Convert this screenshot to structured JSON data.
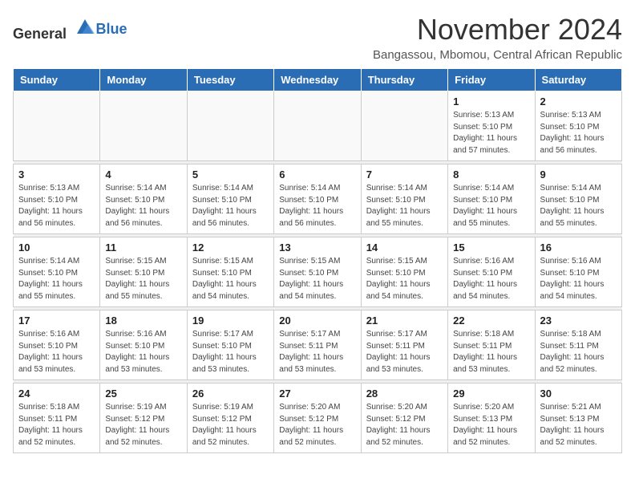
{
  "logo": {
    "general": "General",
    "blue": "Blue"
  },
  "title": "November 2024",
  "subtitle": "Bangassou, Mbomou, Central African Republic",
  "weekdays": [
    "Sunday",
    "Monday",
    "Tuesday",
    "Wednesday",
    "Thursday",
    "Friday",
    "Saturday"
  ],
  "weeks": [
    [
      {
        "day": "",
        "info": ""
      },
      {
        "day": "",
        "info": ""
      },
      {
        "day": "",
        "info": ""
      },
      {
        "day": "",
        "info": ""
      },
      {
        "day": "",
        "info": ""
      },
      {
        "day": "1",
        "info": "Sunrise: 5:13 AM\nSunset: 5:10 PM\nDaylight: 11 hours\nand 57 minutes."
      },
      {
        "day": "2",
        "info": "Sunrise: 5:13 AM\nSunset: 5:10 PM\nDaylight: 11 hours\nand 56 minutes."
      }
    ],
    [
      {
        "day": "3",
        "info": "Sunrise: 5:13 AM\nSunset: 5:10 PM\nDaylight: 11 hours\nand 56 minutes."
      },
      {
        "day": "4",
        "info": "Sunrise: 5:14 AM\nSunset: 5:10 PM\nDaylight: 11 hours\nand 56 minutes."
      },
      {
        "day": "5",
        "info": "Sunrise: 5:14 AM\nSunset: 5:10 PM\nDaylight: 11 hours\nand 56 minutes."
      },
      {
        "day": "6",
        "info": "Sunrise: 5:14 AM\nSunset: 5:10 PM\nDaylight: 11 hours\nand 56 minutes."
      },
      {
        "day": "7",
        "info": "Sunrise: 5:14 AM\nSunset: 5:10 PM\nDaylight: 11 hours\nand 55 minutes."
      },
      {
        "day": "8",
        "info": "Sunrise: 5:14 AM\nSunset: 5:10 PM\nDaylight: 11 hours\nand 55 minutes."
      },
      {
        "day": "9",
        "info": "Sunrise: 5:14 AM\nSunset: 5:10 PM\nDaylight: 11 hours\nand 55 minutes."
      }
    ],
    [
      {
        "day": "10",
        "info": "Sunrise: 5:14 AM\nSunset: 5:10 PM\nDaylight: 11 hours\nand 55 minutes."
      },
      {
        "day": "11",
        "info": "Sunrise: 5:15 AM\nSunset: 5:10 PM\nDaylight: 11 hours\nand 55 minutes."
      },
      {
        "day": "12",
        "info": "Sunrise: 5:15 AM\nSunset: 5:10 PM\nDaylight: 11 hours\nand 54 minutes."
      },
      {
        "day": "13",
        "info": "Sunrise: 5:15 AM\nSunset: 5:10 PM\nDaylight: 11 hours\nand 54 minutes."
      },
      {
        "day": "14",
        "info": "Sunrise: 5:15 AM\nSunset: 5:10 PM\nDaylight: 11 hours\nand 54 minutes."
      },
      {
        "day": "15",
        "info": "Sunrise: 5:16 AM\nSunset: 5:10 PM\nDaylight: 11 hours\nand 54 minutes."
      },
      {
        "day": "16",
        "info": "Sunrise: 5:16 AM\nSunset: 5:10 PM\nDaylight: 11 hours\nand 54 minutes."
      }
    ],
    [
      {
        "day": "17",
        "info": "Sunrise: 5:16 AM\nSunset: 5:10 PM\nDaylight: 11 hours\nand 53 minutes."
      },
      {
        "day": "18",
        "info": "Sunrise: 5:16 AM\nSunset: 5:10 PM\nDaylight: 11 hours\nand 53 minutes."
      },
      {
        "day": "19",
        "info": "Sunrise: 5:17 AM\nSunset: 5:10 PM\nDaylight: 11 hours\nand 53 minutes."
      },
      {
        "day": "20",
        "info": "Sunrise: 5:17 AM\nSunset: 5:11 PM\nDaylight: 11 hours\nand 53 minutes."
      },
      {
        "day": "21",
        "info": "Sunrise: 5:17 AM\nSunset: 5:11 PM\nDaylight: 11 hours\nand 53 minutes."
      },
      {
        "day": "22",
        "info": "Sunrise: 5:18 AM\nSunset: 5:11 PM\nDaylight: 11 hours\nand 53 minutes."
      },
      {
        "day": "23",
        "info": "Sunrise: 5:18 AM\nSunset: 5:11 PM\nDaylight: 11 hours\nand 52 minutes."
      }
    ],
    [
      {
        "day": "24",
        "info": "Sunrise: 5:18 AM\nSunset: 5:11 PM\nDaylight: 11 hours\nand 52 minutes."
      },
      {
        "day": "25",
        "info": "Sunrise: 5:19 AM\nSunset: 5:12 PM\nDaylight: 11 hours\nand 52 minutes."
      },
      {
        "day": "26",
        "info": "Sunrise: 5:19 AM\nSunset: 5:12 PM\nDaylight: 11 hours\nand 52 minutes."
      },
      {
        "day": "27",
        "info": "Sunrise: 5:20 AM\nSunset: 5:12 PM\nDaylight: 11 hours\nand 52 minutes."
      },
      {
        "day": "28",
        "info": "Sunrise: 5:20 AM\nSunset: 5:12 PM\nDaylight: 11 hours\nand 52 minutes."
      },
      {
        "day": "29",
        "info": "Sunrise: 5:20 AM\nSunset: 5:13 PM\nDaylight: 11 hours\nand 52 minutes."
      },
      {
        "day": "30",
        "info": "Sunrise: 5:21 AM\nSunset: 5:13 PM\nDaylight: 11 hours\nand 52 minutes."
      }
    ]
  ]
}
